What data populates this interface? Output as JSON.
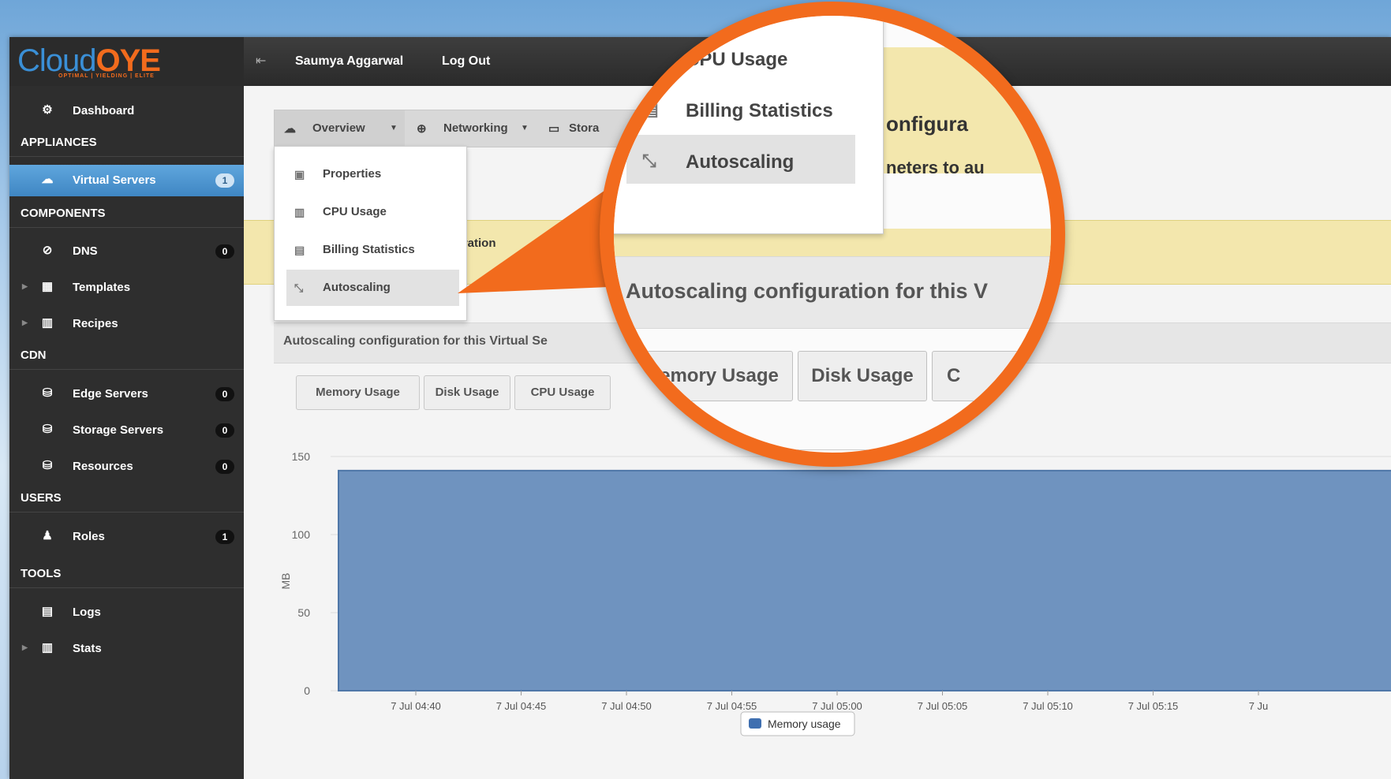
{
  "header": {
    "logo_text_a": "Cloud",
    "logo_text_b": "OYE",
    "logo_tagline": "OPTIMAL | YIELDING | ELITE",
    "user_name": "Saumya Aggarwal",
    "logout_label": "Log Out"
  },
  "sidebar": {
    "dashboard": "Dashboard",
    "sections": {
      "appliances": "APPLIANCES",
      "components": "COMPONENTS",
      "cdn": "CDN",
      "users": "USERS",
      "tools": "TOOLS"
    },
    "items": {
      "virtual_servers": {
        "label": "Virtual Servers",
        "badge": "1"
      },
      "dns": {
        "label": "DNS",
        "badge": "0"
      },
      "templates": {
        "label": "Templates"
      },
      "recipes": {
        "label": "Recipes"
      },
      "edge_servers": {
        "label": "Edge Servers",
        "badge": "0"
      },
      "storage_servers": {
        "label": "Storage Servers",
        "badge": "0"
      },
      "resources": {
        "label": "Resources",
        "badge": "0"
      },
      "roles": {
        "label": "Roles",
        "badge": "1"
      },
      "logs": {
        "label": "Logs"
      },
      "stats": {
        "label": "Stats"
      }
    }
  },
  "tabs": {
    "overview": "Overview",
    "networking": "Networking",
    "storage": "Stora"
  },
  "dropdown": {
    "properties": "Properties",
    "cpu_usage": "CPU Usage",
    "billing": "Billing Statistics",
    "autoscaling": "Autoscaling"
  },
  "notice": {
    "title_fragment": "onfiguration",
    "text_fragment": "neters"
  },
  "config_title": "Autoscaling configuration for this Virtual Se",
  "metric_buttons": {
    "memory": "Memory Usage",
    "disk": "Disk Usage",
    "cpu": "CPU Usage"
  },
  "magnifier": {
    "cpu_usage": "CPU Usage",
    "billing": "Billing Statistics",
    "autoscaling": "Autoscaling",
    "warn_title": "onfigura",
    "warn_text": "neters to au",
    "config_title": "Autoscaling configuration for this V",
    "memory": "Memory Usage",
    "disk": "Disk Usage",
    "cpu_fragment": "C",
    "tick": "150"
  },
  "colors": {
    "accent_orange": "#f26b1d",
    "area_fill": "#6f93bf",
    "active_blue": "#4a90cf"
  },
  "chart_data": {
    "type": "area",
    "ylabel": "MB",
    "ylim": [
      0,
      150
    ],
    "yticks": [
      0,
      50,
      100,
      150
    ],
    "x": [
      "7 Jul 04:40",
      "7 Jul 04:45",
      "7 Jul 04:50",
      "7 Jul 04:55",
      "7 Jul 05:00",
      "7 Jul 05:05",
      "7 Jul 05:10",
      "7 Jul 05:15",
      "7 Ju"
    ],
    "series": [
      {
        "name": "Memory usage",
        "values": [
          141,
          141,
          141,
          141,
          141,
          141,
          141,
          141,
          141
        ]
      }
    ],
    "legend": "bottom-center"
  }
}
